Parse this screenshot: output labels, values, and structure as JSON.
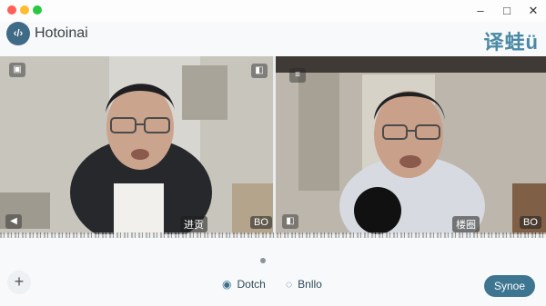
{
  "window": {
    "controls": {
      "minimize": "–",
      "maximize": "□",
      "close": "✕"
    }
  },
  "app": {
    "logo_icon": "code-brackets-icon",
    "logo_glyph": "‹/›",
    "name": "Hotoinai",
    "brand_text": "译蛙",
    "brand_suffix": "ü"
  },
  "call": {
    "left": {
      "top_left_icon": "caption-icon",
      "top_right_icon": "camera-icon",
      "bottom_left_icon": "volume-icon",
      "label": "进贡",
      "badge": "BO"
    },
    "right": {
      "top_left_icon": "chat-icon",
      "bottom_left_icon": "camera-icon",
      "label": "楼圈",
      "badge": "BO"
    }
  },
  "controls": {
    "add_label": "+",
    "watch_label": "Dotch",
    "voice_label": "Bnllo",
    "main_button_label": "Synoe"
  },
  "colors": {
    "accent": "#3e7591",
    "brand": "#4b8aa6"
  }
}
